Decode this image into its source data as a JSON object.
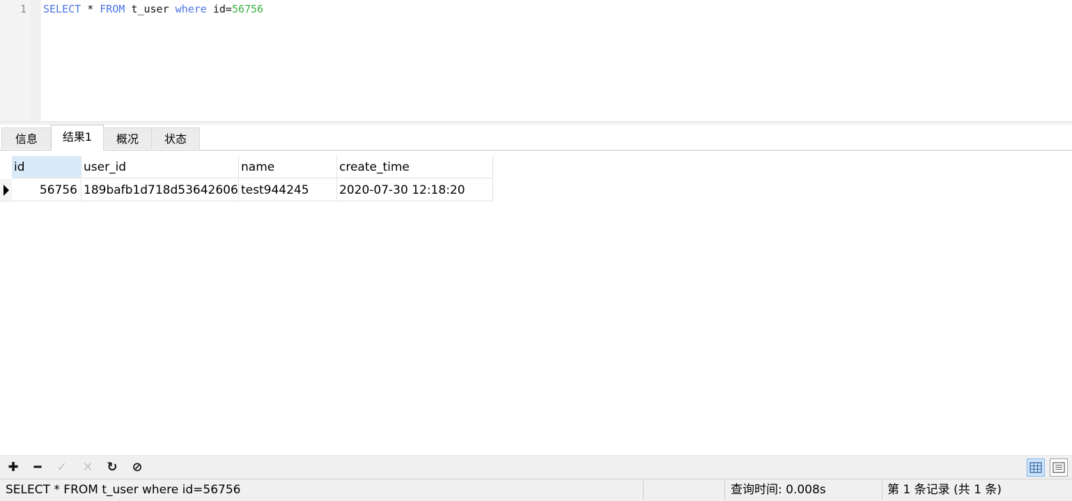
{
  "editor": {
    "line_number": "1",
    "tokens": {
      "select": "SELECT",
      "star": " * ",
      "from": "FROM",
      "table": " t_user ",
      "where": "where",
      "cond": " id=",
      "value": "56756"
    }
  },
  "tabs": [
    {
      "label": "信息"
    },
    {
      "label": "结果1"
    },
    {
      "label": "概况"
    },
    {
      "label": "状态"
    }
  ],
  "active_tab": "结果1",
  "grid": {
    "columns": [
      "id",
      "user_id",
      "name",
      "create_time"
    ],
    "rows": [
      [
        "56756",
        "189bafb1d718d53642606",
        "test944245",
        "2020-07-30 12:18:20"
      ]
    ]
  },
  "toolbar": {
    "add_icon": "plus-icon",
    "delete_icon": "minus-icon",
    "apply_icon": "check-icon",
    "discard_icon": "x-icon",
    "refresh_icon": "refresh-icon",
    "stop_icon": "stop-icon",
    "grid_view_icon": "grid-view-icon",
    "form_view_icon": "form-view-icon",
    "add_glyph": "✚",
    "delete_glyph": "━",
    "apply_glyph": "✓",
    "discard_glyph": "✕",
    "refresh_glyph": "↻",
    "stop_glyph": "⊘"
  },
  "status": {
    "sql": "SELECT * FROM t_user where id=56756",
    "query_time": "查询时间: 0.008s",
    "records": "第 1 条记录 (共 1 条)"
  }
}
